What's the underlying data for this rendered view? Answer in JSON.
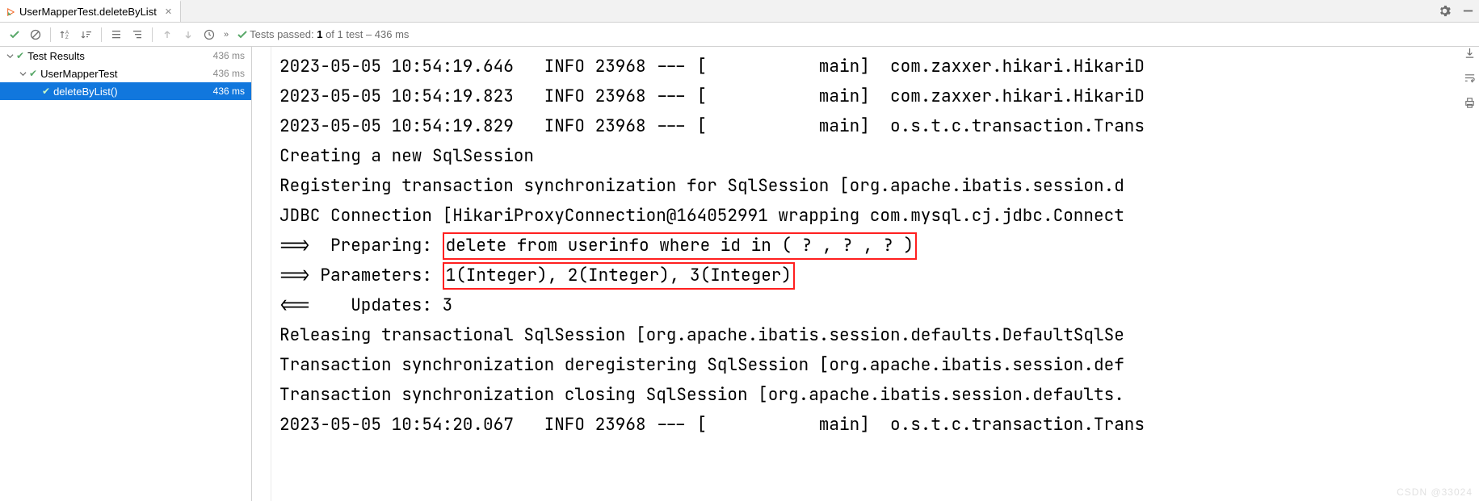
{
  "tab": {
    "label": "UserMapperTest.deleteByList"
  },
  "status": {
    "prefix": "Tests passed: ",
    "strong": "1",
    "rest": " of 1 test – 436 ms"
  },
  "tree": {
    "root": {
      "label": "Test Results",
      "dur": "436 ms"
    },
    "class": {
      "label": "UserMapperTest",
      "dur": "436 ms"
    },
    "method": {
      "label": "deleteByList()",
      "dur": "436 ms"
    }
  },
  "console": {
    "l1": "2023-05-05 10:54:19.646   INFO 23968 --- [           main]  com.zaxxer.hikari.HikariD",
    "l2": "2023-05-05 10:54:19.823   INFO 23968 --- [           main]  com.zaxxer.hikari.HikariD",
    "l3": "2023-05-05 10:54:19.829   INFO 23968 --- [           main]  o.s.t.c.transaction.Trans",
    "l4": "Creating a new SqlSession",
    "l5": "Registering transaction synchronization for SqlSession [org.apache.ibatis.session.d",
    "l6": "JDBC Connection [HikariProxyConnection@164052991 wrapping com.mysql.cj.jdbc.Connect",
    "l7_pre": "==>  Preparing: ",
    "l7_hl": "delete from userinfo where id in ( ? , ? , ? )",
    "l8_pre": "==> Parameters: ",
    "l8_hl": "1(Integer), 2(Integer), 3(Integer)",
    "l9": "<==    Updates: 3",
    "l10": "Releasing transactional SqlSession [org.apache.ibatis.session.defaults.DefaultSqlSe",
    "l11": "Transaction synchronization deregistering SqlSession [org.apache.ibatis.session.def",
    "l12": "Transaction synchronization closing SqlSession [org.apache.ibatis.session.defaults.",
    "l13": "2023-05-05 10:54:20.067   INFO 23968 --- [           main]  o.s.t.c.transaction.Trans"
  },
  "watermark": "CSDN @33024"
}
